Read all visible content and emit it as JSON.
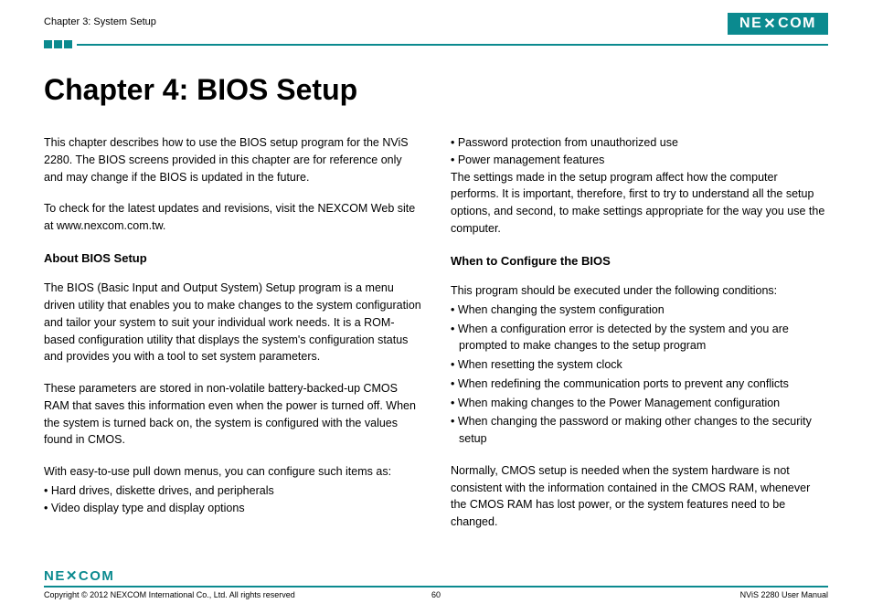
{
  "header": {
    "chapter_label": "Chapter 3: System Setup",
    "logo_text": "NE COM",
    "logo_x": "X"
  },
  "title": "Chapter 4: BIOS Setup",
  "left_col": {
    "p1": "This chapter describes how to use the BIOS setup program for the NViS 2280. The BIOS screens provided in this chapter are for reference only and may change if the BIOS is updated in the future.",
    "p2": "To check for the latest updates and revisions, visit the NEXCOM Web site at www.nexcom.com.tw.",
    "h1": "About BIOS Setup",
    "p3": "The BIOS (Basic Input and Output System) Setup program is a menu driven utility that enables you to make changes to the system configuration and tailor your system to suit your individual work needs. It is a ROM-based configuration utility that displays the system's configuration status and provides you with a tool to set system parameters.",
    "p4": "These parameters are stored in non-volatile battery-backed-up CMOS RAM that saves this information even when the power is turned off. When the system is turned back on, the system is configured with the values found in CMOS.",
    "p5": "With easy-to-use pull down menus, you can configure such items as:",
    "b1": "• Hard drives, diskette drives, and peripherals",
    "b2": "• Video display type and display options"
  },
  "right_col": {
    "b1": "• Password protection from unauthorized use",
    "b2": "• Power management features",
    "p1": "The settings made in the setup program affect how the computer performs. It is important, therefore, first to try to understand all the setup options, and second, to make settings appropriate for the way you use the computer.",
    "h1": "When to Configure the BIOS",
    "p2": "This program should be executed under the following conditions:",
    "c1": "• When changing the system configuration",
    "c2": "• When a configuration error is detected by the system and you are prompted to make changes to the setup program",
    "c3": "• When resetting the system clock",
    "c4": "• When redefining the communication ports to prevent any conflicts",
    "c5": "• When making changes to the Power Management configuration",
    "c6": "• When changing the password or making other changes to the security setup",
    "p3": "Normally, CMOS setup is needed when the system hardware is not consistent with the information contained in the CMOS RAM, whenever the CMOS RAM has lost power, or the system features need to be changed."
  },
  "footer": {
    "logo_text": "NE COM",
    "logo_x": "X",
    "copyright": "Copyright © 2012 NEXCOM International Co., Ltd. All rights reserved",
    "page": "60",
    "manual": "NViS 2280 User Manual"
  }
}
